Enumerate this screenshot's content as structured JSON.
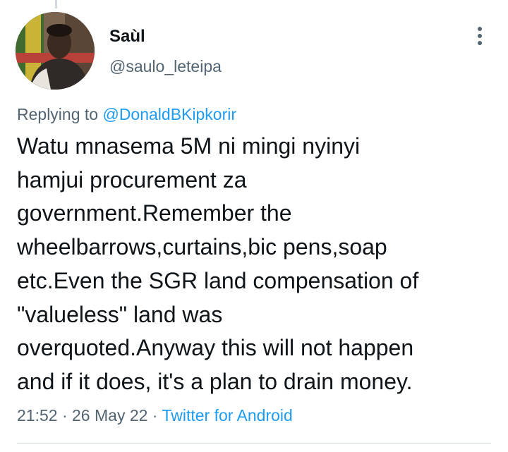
{
  "author": {
    "display_name": "Saùl",
    "handle": "@saulo_leteipa"
  },
  "reply": {
    "prefix": "Replying to ",
    "mention": "@DonaldBKipkorir"
  },
  "tweet": {
    "lines": [
      "Watu mnasema 5M ni mingi nyinyi",
      "hamjui procurement za",
      "government.Remember the",
      "wheelbarrows,curtains,bic pens,soap",
      "etc.Even the SGR land compensation of",
      "\"valueless\" land was",
      "overquoted.Anyway this will not happen",
      "and if it does, it's a plan to drain money."
    ]
  },
  "meta": {
    "time": "21:52",
    "separator_1": " · ",
    "date": "26 May 22",
    "separator_2": " · ",
    "source": "Twitter for Android"
  },
  "icons": {
    "more": "more-vertical-icon"
  },
  "colors": {
    "link": "#1d9bf0",
    "secondary_text": "#536471",
    "primary_text": "#0f1419",
    "divider": "#cfd9de"
  }
}
